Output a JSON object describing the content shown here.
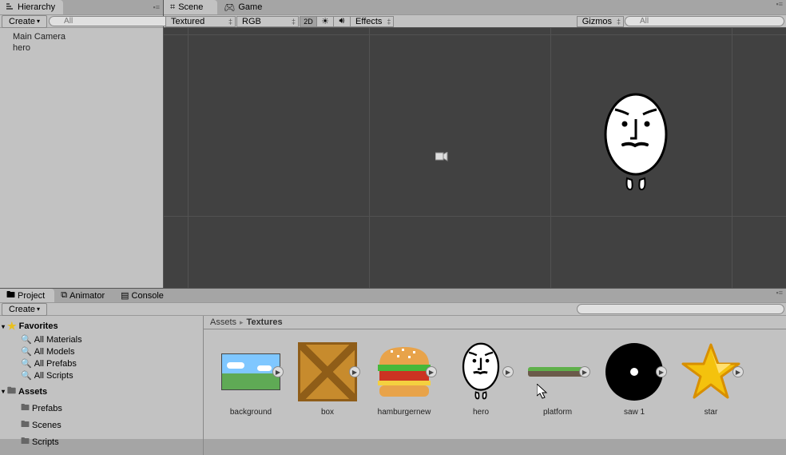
{
  "hierarchy": {
    "tab_label": "Hierarchy",
    "create_label": "Create",
    "search_placeholder": "All",
    "items": [
      "Main Camera",
      "hero"
    ]
  },
  "scene": {
    "tab_scene": "Scene",
    "tab_game": "Game",
    "shading_mode": "Textured",
    "render_mode": "RGB",
    "btn_2d": "2D",
    "effects_label": "Effects",
    "gizmos_label": "Gizmos",
    "search_placeholder": "All"
  },
  "project": {
    "tab_project": "Project",
    "tab_animator": "Animator",
    "tab_console": "Console",
    "create_label": "Create",
    "search_placeholder": "",
    "favorites_label": "Favorites",
    "favorites": [
      "All Materials",
      "All Models",
      "All Prefabs",
      "All Scripts"
    ],
    "assets_label": "Assets",
    "asset_folders": [
      "Prefabs",
      "Scenes",
      "Scripts"
    ],
    "breadcrumb": [
      "Assets",
      "Textures"
    ],
    "items": [
      {
        "key": "background",
        "label": "background"
      },
      {
        "key": "box",
        "label": "box"
      },
      {
        "key": "hamburgernew",
        "label": "hamburgernew"
      },
      {
        "key": "hero",
        "label": "hero"
      },
      {
        "key": "platform",
        "label": "platform"
      },
      {
        "key": "saw1",
        "label": "saw 1"
      },
      {
        "key": "star",
        "label": "star"
      }
    ]
  }
}
